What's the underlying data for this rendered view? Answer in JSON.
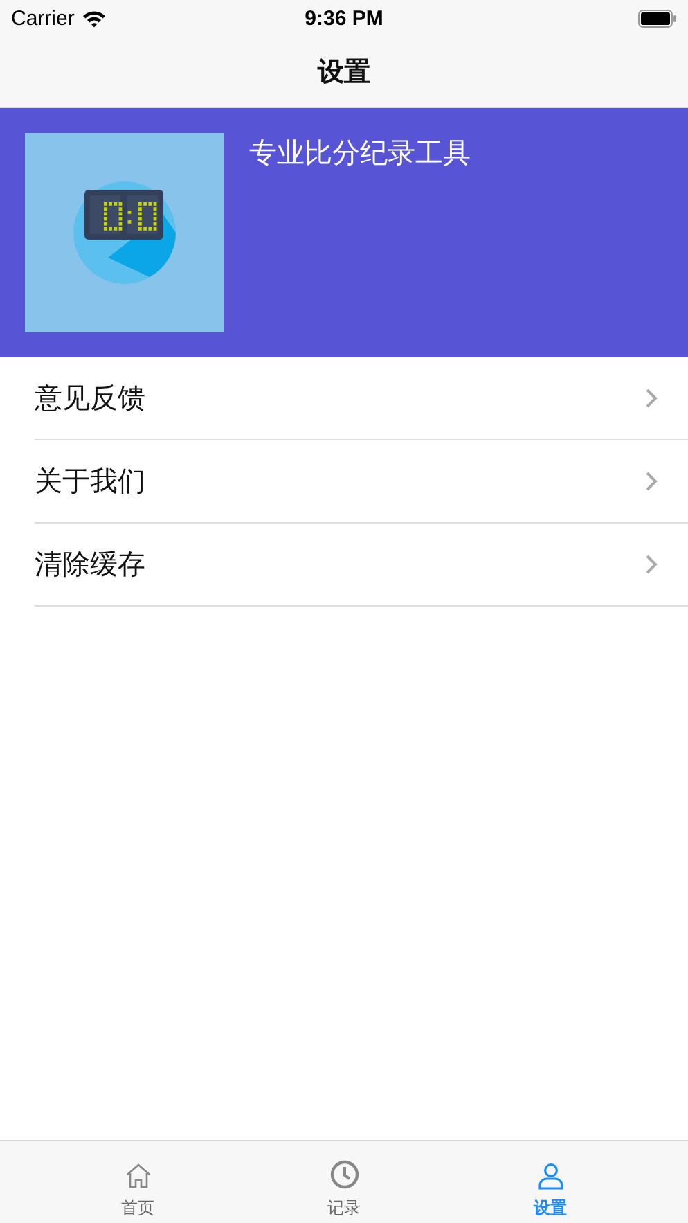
{
  "status_bar": {
    "carrier": "Carrier",
    "time": "9:36 PM"
  },
  "nav": {
    "title": "设置"
  },
  "banner": {
    "title": "专业比分纪录工具"
  },
  "menu": [
    {
      "label": "意见反馈"
    },
    {
      "label": "关于我们"
    },
    {
      "label": "清除缓存"
    }
  ],
  "tabs": [
    {
      "label": "首页",
      "kind": "home",
      "selected": false
    },
    {
      "label": "记录",
      "kind": "clock",
      "selected": false
    },
    {
      "label": "设置",
      "kind": "person",
      "selected": true
    }
  ]
}
